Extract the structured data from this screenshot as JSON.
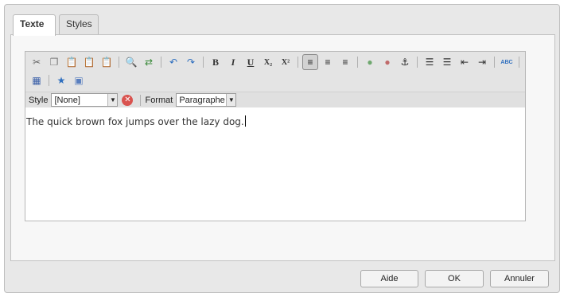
{
  "tabs": [
    {
      "label": "Texte",
      "active": true
    },
    {
      "label": "Styles",
      "active": false
    }
  ],
  "toolbar": {
    "row1": [
      {
        "icon": "cut-icon"
      },
      {
        "icon": "copy-icon"
      },
      {
        "icon": "paste-icon"
      },
      {
        "icon": "paste-text-icon"
      },
      {
        "icon": "paste-word-icon"
      },
      {
        "sep": true
      },
      {
        "icon": "find-icon"
      },
      {
        "icon": "replace-icon"
      },
      {
        "sep": true
      },
      {
        "icon": "undo-icon"
      },
      {
        "icon": "redo-icon"
      },
      {
        "sep": true
      },
      {
        "icon": "bold-icon",
        "text": "B"
      },
      {
        "icon": "italic-icon",
        "text": "I"
      },
      {
        "icon": "underline-icon",
        "text": "U"
      },
      {
        "icon": "subscript-icon",
        "text": "X₂"
      },
      {
        "icon": "superscript-icon",
        "text": "X²"
      },
      {
        "sep": true
      },
      {
        "icon": "align-left-icon",
        "pressed": true
      },
      {
        "icon": "align-center-icon"
      },
      {
        "icon": "align-right-icon"
      },
      {
        "sep": true
      },
      {
        "icon": "link-icon"
      },
      {
        "icon": "unlink-icon"
      },
      {
        "icon": "anchor-icon"
      },
      {
        "sep": true
      },
      {
        "icon": "bulleted-list-icon"
      },
      {
        "icon": "numbered-list-icon"
      },
      {
        "icon": "outdent-icon"
      },
      {
        "icon": "indent-icon"
      },
      {
        "sep": true
      },
      {
        "icon": "spellcheck-icon",
        "text": "ABC"
      },
      {
        "sep": true
      }
    ],
    "row2": [
      {
        "icon": "table-icon"
      },
      {
        "sep": true
      },
      {
        "icon": "special-char-icon"
      },
      {
        "icon": "image-icon"
      }
    ]
  },
  "style_bar": {
    "style_label": "Style",
    "style_value": "[None]",
    "format_label": "Format",
    "format_value": "Paragraphe"
  },
  "content": {
    "text": "The quick brown fox jumps over the lazy dog."
  },
  "buttons": {
    "help": "Aide",
    "ok": "OK",
    "cancel": "Annuler"
  }
}
